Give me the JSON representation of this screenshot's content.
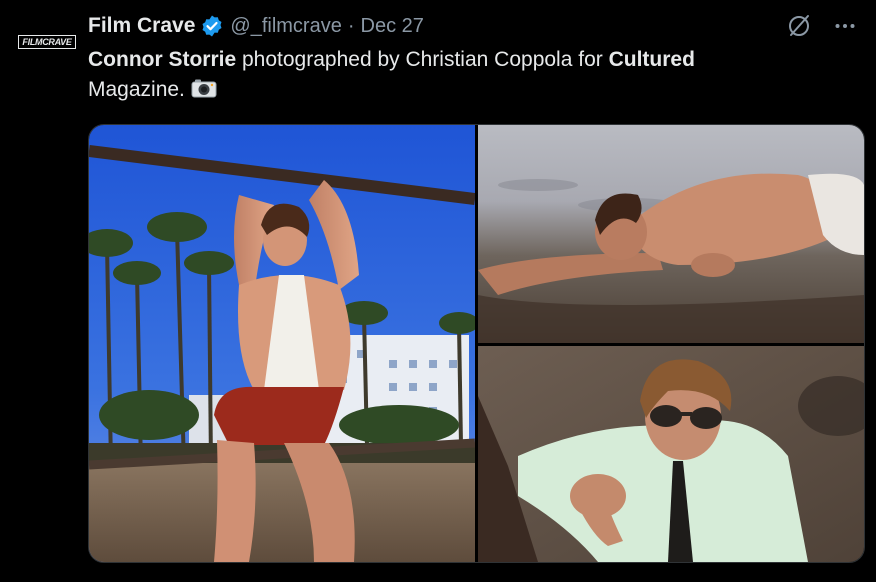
{
  "author": {
    "logo_text": "FILMCRAVE",
    "name": "Film Crave",
    "handle": "@_filmcrave",
    "separator": "·",
    "date": "Dec 27"
  },
  "icons": {
    "verified": "verified-badge-icon",
    "grok": "grok-icon",
    "more": "more-icon",
    "camera": "camera-emoji-icon"
  },
  "tweet": {
    "bold1": "Connor Storrie",
    "text1": " photographed by Christian Coppola for ",
    "bold2": "Cultured",
    "text2": " Magazine."
  },
  "media": {
    "photos": [
      {
        "subject": "man-on-bar-photo"
      },
      {
        "subject": "man-on-beach-photo"
      },
      {
        "subject": "man-in-sunglasses-photo"
      }
    ]
  },
  "colors": {
    "background": "#000000",
    "text": "#e7e9ea",
    "secondary": "#8b98a5",
    "verified": "#1d9bf0",
    "border": "#2f3336"
  }
}
